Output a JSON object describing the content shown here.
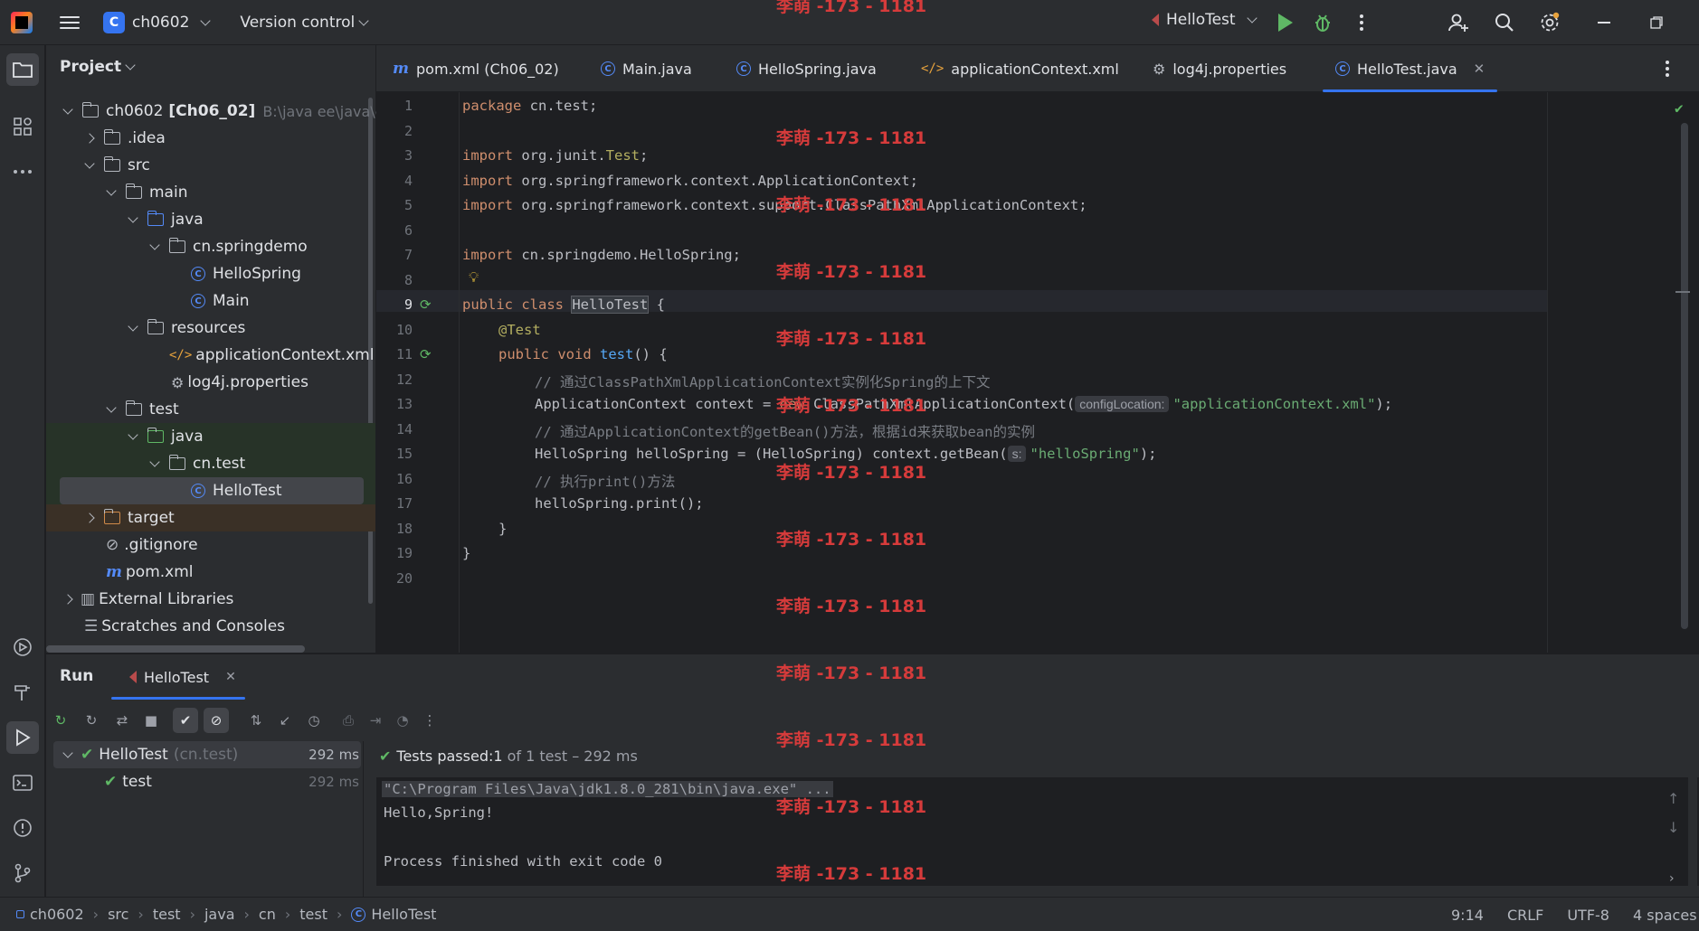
{
  "titlebar": {
    "project_initial": "C",
    "project_name": "ch0602",
    "version_control": "Version control",
    "run_config": "HelloTest"
  },
  "project_panel": {
    "title": "Project",
    "tree": [
      {
        "label": "ch0602",
        "bold_suffix": "[Ch06_02]",
        "path": "B:\\java ee\\java\\ch"
      },
      {
        "label": ".idea"
      },
      {
        "label": "src"
      },
      {
        "label": "main"
      },
      {
        "label": "java"
      },
      {
        "label": "cn.springdemo"
      },
      {
        "label": "HelloSpring"
      },
      {
        "label": "Main"
      },
      {
        "label": "resources"
      },
      {
        "label": "applicationContext.xml"
      },
      {
        "label": "log4j.properties"
      },
      {
        "label": "test"
      },
      {
        "label": "java"
      },
      {
        "label": "cn.test"
      },
      {
        "label": "HelloTest"
      },
      {
        "label": "target"
      },
      {
        "label": ".gitignore"
      },
      {
        "label": "pom.xml"
      },
      {
        "label": "External Libraries"
      },
      {
        "label": "Scratches and Consoles"
      }
    ]
  },
  "tabs": [
    {
      "label": "pom.xml (Ch06_02)"
    },
    {
      "label": "Main.java"
    },
    {
      "label": "HelloSpring.java"
    },
    {
      "label": "applicationContext.xml"
    },
    {
      "label": "log4j.properties"
    },
    {
      "label": "HelloTest.java"
    }
  ],
  "editor": {
    "line_numbers": [
      "1",
      "2",
      "3",
      "4",
      "5",
      "6",
      "7",
      "8",
      "9",
      "10",
      "11",
      "12",
      "13",
      "14",
      "15",
      "16",
      "17",
      "18",
      "19",
      "20"
    ],
    "code": {
      "l1_kw": "package",
      "l1_rest": " cn.test;",
      "l3_kw": "import",
      "l3_pre": " org.junit.",
      "l3_cls": "Test",
      "l3_end": ";",
      "l4_kw": "import",
      "l4_rest": " org.springframework.context.ApplicationContext;",
      "l5_kw": "import",
      "l5_rest": " org.springframework.context.support.ClassPathXmlApplicationContext;",
      "l7_kw": "import",
      "l7_rest": " cn.springdemo.HelloSpring;",
      "l9_kw": "public class",
      "l9_name": "HelloTest",
      "l9_end": " {",
      "l10_ann": "@Test",
      "l11_kw": "public void",
      "l11_fn": "test",
      "l11_end": "() {",
      "l12_cmt": "// 通过ClassPathXmlApplicationContext实例化Spring的上下文",
      "l13_pre": "ApplicationContext context = ",
      "l13_kw": "new",
      "l13_mid": " ClassPathXmlApplicationContext(",
      "l13_hint": "configLocation:",
      "l13_str": "\"applicationContext.xml\"",
      "l13_end": ");",
      "l14_cmt": "// 通过ApplicationContext的getBean()方法，根据id来获取bean的实例",
      "l15_pre": "HelloSpring helloSpring = (HelloSpring) context.getBean(",
      "l15_hint": "s:",
      "l15_str": "\"helloSpring\"",
      "l15_end": ");",
      "l16_cmt": "// 执行print()方法",
      "l17_code": "helloSpring.print();",
      "l18_code": "}",
      "l19_code": "}"
    }
  },
  "run_panel": {
    "title": "Run",
    "tab": "HelloTest",
    "tests": [
      {
        "name": "HelloTest",
        "pkg": "(cn.test)",
        "time": "292 ms"
      },
      {
        "name": "test",
        "time": "292 ms"
      }
    ],
    "status_prefix": "Tests passed: ",
    "status_count": "1",
    "status_suffix": " of 1 test – 292 ms",
    "console": [
      "\"C:\\Program Files\\Java\\jdk1.8.0_281\\bin\\java.exe\" ...",
      "Hello,Spring!",
      "",
      "Process finished with exit code 0"
    ]
  },
  "statusbar": {
    "breadcrumbs": [
      "ch0602",
      "src",
      "test",
      "java",
      "cn",
      "test",
      "HelloTest"
    ],
    "position": "9:14",
    "line_sep": "CRLF",
    "encoding": "UTF-8",
    "indent": "4 spaces"
  },
  "watermark": "李萌 -173 - 1181"
}
